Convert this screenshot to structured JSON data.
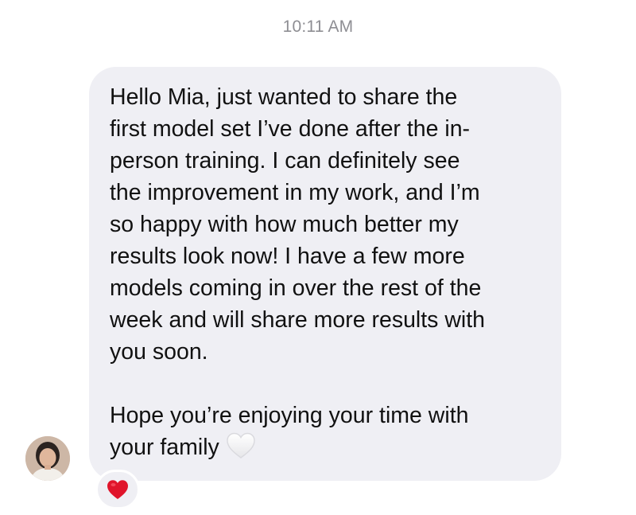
{
  "conversation": {
    "timestamp": "10:11 AM",
    "message": {
      "lines": [
        "Hello Mia, just wanted to share the",
        "first model set I’ve done after the in-",
        "person training. I can definitely see",
        "the improvement in my work, and I’m",
        "so happy with how much better my",
        "results look now! I have a few more",
        "models coming in over the rest of the",
        "week and will share more results with",
        "you soon.",
        "",
        "Hope you’re enjoying your time with",
        "your family"
      ],
      "trailing_emoji": "white-heart-icon"
    },
    "reaction": {
      "icon": "red-heart-icon",
      "color": "#e0142b"
    },
    "avatar": {
      "icon": "contact-avatar"
    }
  }
}
